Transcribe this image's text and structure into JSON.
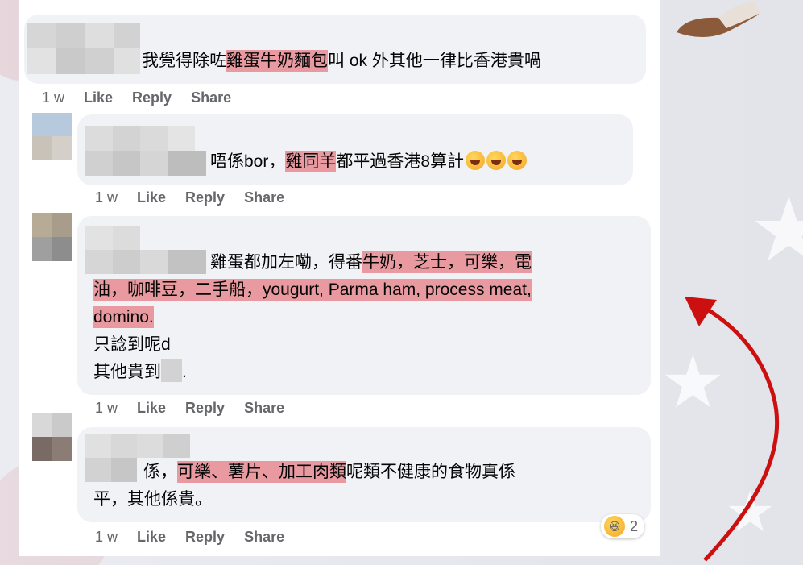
{
  "comments": [
    {
      "text_parts": [
        {
          "t": "我覺得除咗",
          "hl": false
        },
        {
          "t": "雞蛋牛奶麵包",
          "hl": true
        },
        {
          "t": "叫 ok 外其他一律比香港貴喎",
          "hl": false
        }
      ],
      "time": "1 w",
      "like": "Like",
      "reply": "Reply",
      "share": "Share"
    },
    {
      "text_parts": [
        {
          "t": "唔係bor，",
          "hl": false
        },
        {
          "t": "雞同羊",
          "hl": true
        },
        {
          "t": "都平過香港8算計",
          "hl": false
        }
      ],
      "emoji_count": 3,
      "time": "1 w",
      "like": "Like",
      "reply": "Reply",
      "share": "Share"
    },
    {
      "lines": [
        [
          {
            "t": "雞蛋都加左嘞，得番",
            "hl": false
          },
          {
            "t": "牛奶，芝士，可樂，電",
            "hl": true
          }
        ],
        [
          {
            "t": "油，咖啡豆，二手船，yougurt, Parma ham, process meat,",
            "hl": true
          }
        ],
        [
          {
            "t": "domino.",
            "hl": true
          }
        ],
        [
          {
            "t": "只諗到呢d",
            "hl": false
          }
        ],
        [
          {
            "t": "其他貴到",
            "hl": false
          }
        ]
      ],
      "trailing": ".",
      "time": "1 w",
      "like": "Like",
      "reply": "Reply",
      "share": "Share"
    },
    {
      "lines": [
        [
          {
            "t": "係，",
            "hl": false
          },
          {
            "t": "可樂、薯片、加工肉類",
            "hl": true
          },
          {
            "t": "呢類不健康的食物真係",
            "hl": false
          }
        ],
        [
          {
            "t": "平，其他係貴。",
            "hl": false
          }
        ]
      ],
      "reaction_count": "2",
      "time": "1 w",
      "like": "Like",
      "reply": "Reply",
      "share": "Share"
    }
  ],
  "colors": {
    "highlight": "#e89aa0",
    "bubble": "#f0f2f5",
    "action": "#65676b",
    "arrow": "#cc1010"
  },
  "icons": {
    "reaction": "laughing-emoji-icon",
    "arrow": "red-curved-arrow-icon"
  }
}
